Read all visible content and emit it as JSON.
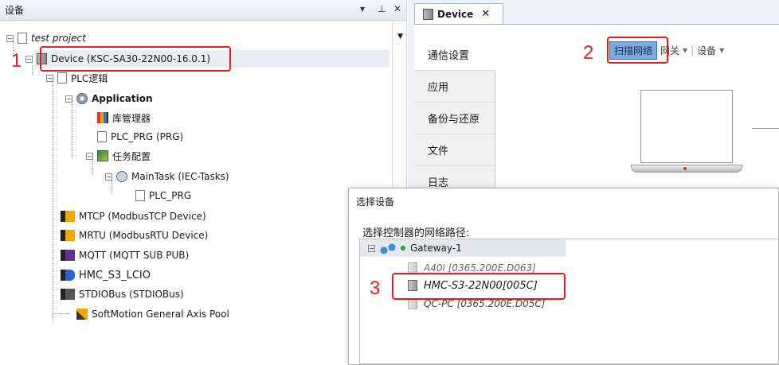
{
  "left_pane": {
    "title": "设备",
    "controls": {
      "dropdown": "▾",
      "pin": "⊥",
      "close": "✕"
    },
    "tree": {
      "project": "test project",
      "device": "Device (KSC-SA30-22N00-16.0.1)",
      "plc_logic": "PLC逻辑",
      "application": "Application",
      "library_manager": "库管理器",
      "plc_prg": "PLC_PRG (PRG)",
      "task_config": "任务配置",
      "main_task": "MainTask (IEC-Tasks)",
      "main_task_prg": "PLC_PRG",
      "mtcp": "MTCP (ModbusTCP Device)",
      "mrtu": "MRTU (ModbusRTU Device)",
      "mqtt": "MQTT (MQTT SUB PUB)",
      "hmc": "HMC_S3_LCIO",
      "stdiobus": "STDIOBus (STDIOBus)",
      "softmotion": "SoftMotion General Axis Pool"
    }
  },
  "editor": {
    "tab_label": "Device",
    "tab_close": "✕",
    "side_menu": [
      "通信设置",
      "应用",
      "备份与还原",
      "文件",
      "日志"
    ],
    "toolbar": {
      "scan": "扫描网络",
      "gateway": "网关",
      "device": "设备",
      "dropdown": "▾",
      "separator": "|"
    }
  },
  "dialog": {
    "title": "选择设备",
    "label": "选择控制器的网络路径:",
    "gateway": "Gateway-1",
    "devices": [
      "A40i [0365.200E.D063]",
      "HMC-S3-22N00[005C]",
      "QC-PC [0365.200E.D05C]"
    ]
  },
  "annotations": {
    "step1": "1",
    "step2": "2",
    "step3": "3"
  },
  "colors": {
    "annotation_red": "#e02020",
    "scan_button": "#7fa8dc",
    "gateway_status": "#2aa02a"
  }
}
